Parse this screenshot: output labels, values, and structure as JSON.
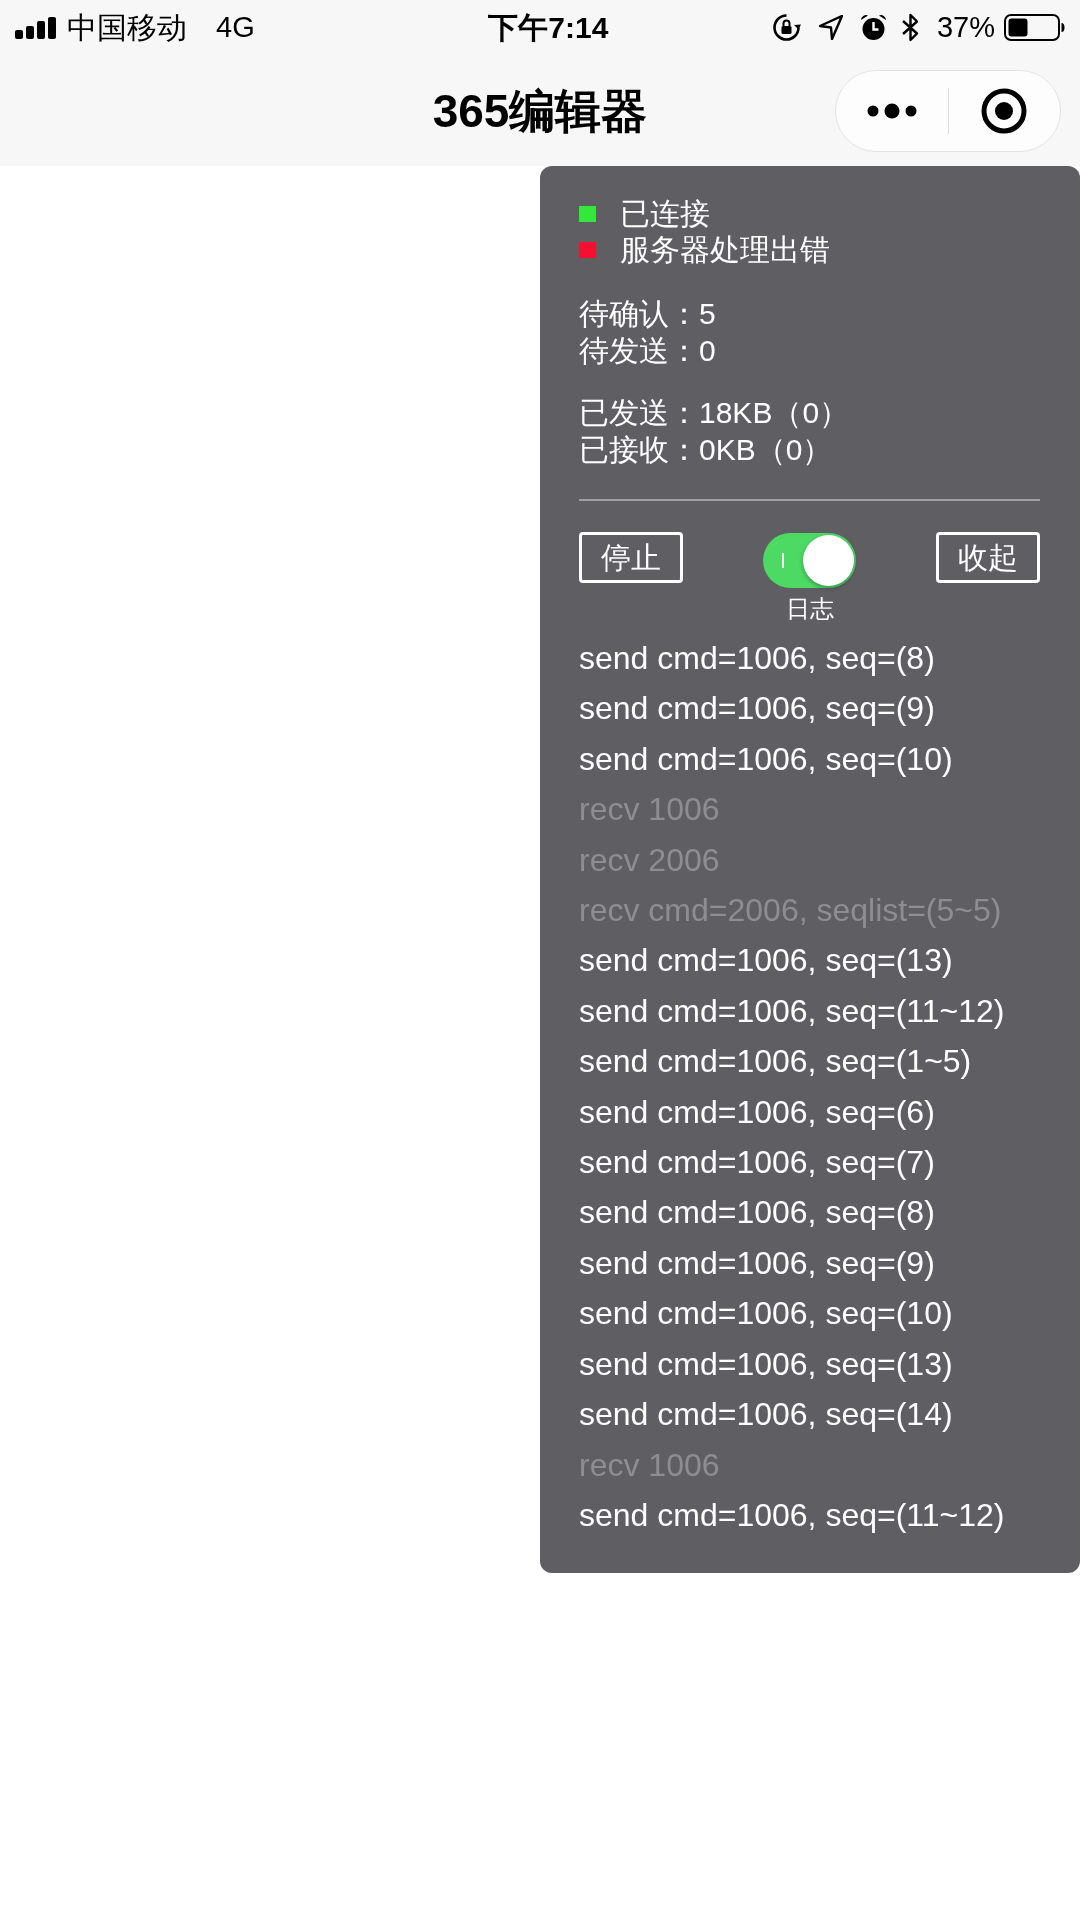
{
  "status_bar": {
    "carrier": "中国移动",
    "network": "4G",
    "time": "下午7:14",
    "battery": "37%"
  },
  "nav_bar": {
    "title": "365编辑器"
  },
  "debug_panel": {
    "connection": [
      {
        "label": "已连接",
        "color": "#33e83a"
      },
      {
        "label": "服务器处理出错",
        "color": "#f5102f"
      }
    ],
    "queue": [
      "待确认：5",
      "待发送：0"
    ],
    "traffic": [
      "已发送：18KB（0）",
      "已接收：0KB（0）"
    ],
    "stop_button": "停止",
    "log_switch": {
      "label": "日志",
      "on": true
    },
    "collapse_button": "收起",
    "log": [
      {
        "kind": "send",
        "text": "send cmd=1006, seq=(8)"
      },
      {
        "kind": "send",
        "text": "send cmd=1006, seq=(9)"
      },
      {
        "kind": "send",
        "text": "send cmd=1006, seq=(10)"
      },
      {
        "kind": "recv",
        "text": "recv 1006"
      },
      {
        "kind": "recv",
        "text": "recv 2006"
      },
      {
        "kind": "recv",
        "text": "recv cmd=2006, seqlist=(5~5)"
      },
      {
        "kind": "send",
        "text": "send cmd=1006, seq=(13)"
      },
      {
        "kind": "send",
        "text": "send cmd=1006, seq=(11~12)"
      },
      {
        "kind": "send",
        "text": "send cmd=1006, seq=(1~5)"
      },
      {
        "kind": "send",
        "text": "send cmd=1006, seq=(6)"
      },
      {
        "kind": "send",
        "text": "send cmd=1006, seq=(7)"
      },
      {
        "kind": "send",
        "text": "send cmd=1006, seq=(8)"
      },
      {
        "kind": "send",
        "text": "send cmd=1006, seq=(9)"
      },
      {
        "kind": "send",
        "text": "send cmd=1006, seq=(10)"
      },
      {
        "kind": "send",
        "text": "send cmd=1006, seq=(13)"
      },
      {
        "kind": "send",
        "text": "send cmd=1006, seq=(14)"
      },
      {
        "kind": "recv",
        "text": "recv 1006"
      },
      {
        "kind": "send",
        "text": "send cmd=1006, seq=(11~12)"
      }
    ]
  }
}
